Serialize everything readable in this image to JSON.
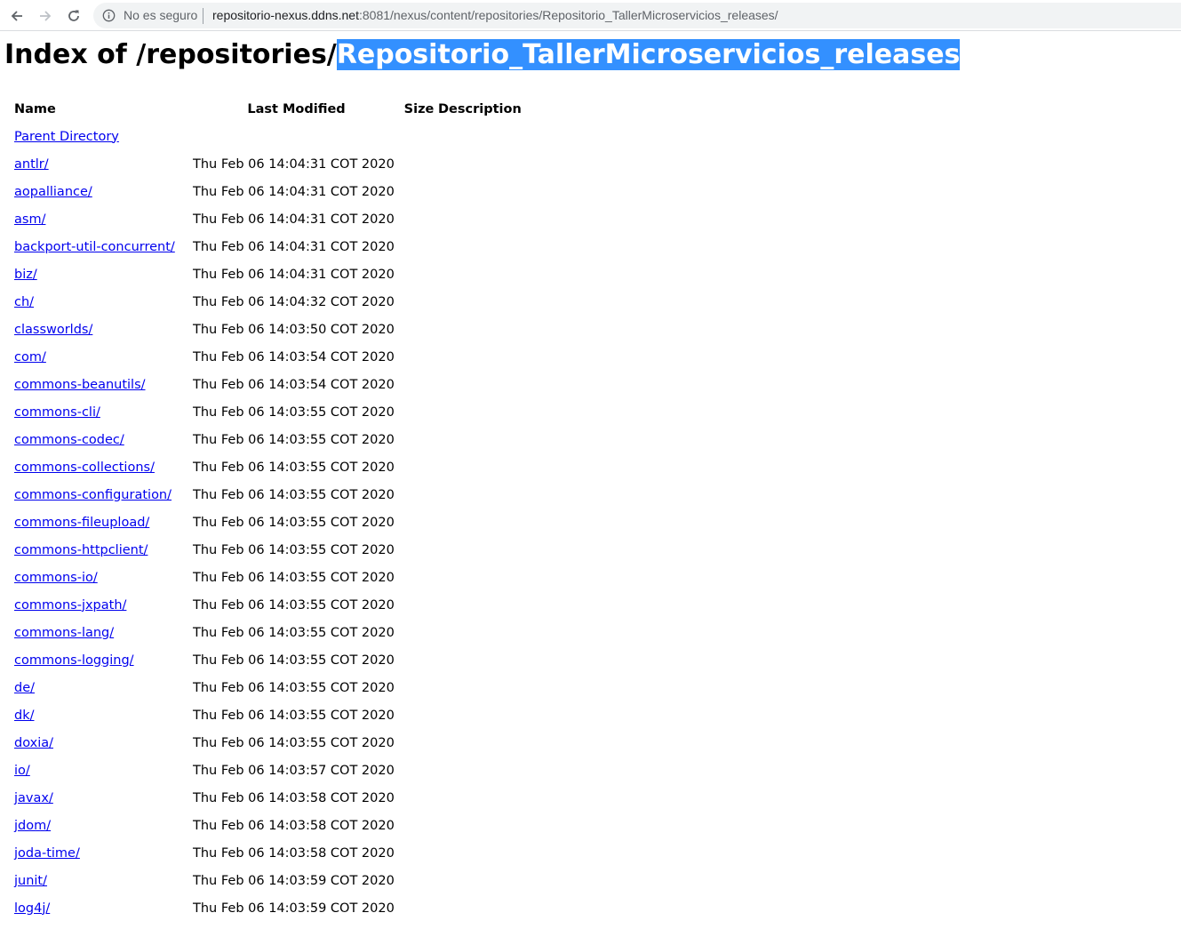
{
  "browser": {
    "security_label": "No es seguro",
    "url_host": "repositorio-nexus.ddns.net",
    "url_path": ":8081/nexus/content/repositories/Repositorio_TallerMicroservicios_releases/"
  },
  "page": {
    "title_prefix": "Index of /repositories/",
    "title_selected": "Repositorio_TallerMicroservicios_releases"
  },
  "table": {
    "headers": {
      "name": "Name",
      "last_modified": "Last Modified",
      "size": "Size",
      "description": "Description"
    },
    "parent_label": "Parent Directory",
    "rows": [
      {
        "name": "antlr/",
        "modified": "Thu Feb 06 14:04:31 COT 2020"
      },
      {
        "name": "aopalliance/",
        "modified": "Thu Feb 06 14:04:31 COT 2020"
      },
      {
        "name": "asm/",
        "modified": "Thu Feb 06 14:04:31 COT 2020"
      },
      {
        "name": "backport-util-concurrent/",
        "modified": "Thu Feb 06 14:04:31 COT 2020"
      },
      {
        "name": "biz/",
        "modified": "Thu Feb 06 14:04:31 COT 2020"
      },
      {
        "name": "ch/",
        "modified": "Thu Feb 06 14:04:32 COT 2020"
      },
      {
        "name": "classworlds/",
        "modified": "Thu Feb 06 14:03:50 COT 2020"
      },
      {
        "name": "com/",
        "modified": "Thu Feb 06 14:03:54 COT 2020"
      },
      {
        "name": "commons-beanutils/",
        "modified": "Thu Feb 06 14:03:54 COT 2020"
      },
      {
        "name": "commons-cli/",
        "modified": "Thu Feb 06 14:03:55 COT 2020"
      },
      {
        "name": "commons-codec/",
        "modified": "Thu Feb 06 14:03:55 COT 2020"
      },
      {
        "name": "commons-collections/",
        "modified": "Thu Feb 06 14:03:55 COT 2020"
      },
      {
        "name": "commons-configuration/",
        "modified": "Thu Feb 06 14:03:55 COT 2020"
      },
      {
        "name": "commons-fileupload/",
        "modified": "Thu Feb 06 14:03:55 COT 2020"
      },
      {
        "name": "commons-httpclient/",
        "modified": "Thu Feb 06 14:03:55 COT 2020"
      },
      {
        "name": "commons-io/",
        "modified": "Thu Feb 06 14:03:55 COT 2020"
      },
      {
        "name": "commons-jxpath/",
        "modified": "Thu Feb 06 14:03:55 COT 2020"
      },
      {
        "name": "commons-lang/",
        "modified": "Thu Feb 06 14:03:55 COT 2020"
      },
      {
        "name": "commons-logging/",
        "modified": "Thu Feb 06 14:03:55 COT 2020"
      },
      {
        "name": "de/",
        "modified": "Thu Feb 06 14:03:55 COT 2020"
      },
      {
        "name": "dk/",
        "modified": "Thu Feb 06 14:03:55 COT 2020"
      },
      {
        "name": "doxia/",
        "modified": "Thu Feb 06 14:03:55 COT 2020"
      },
      {
        "name": "io/",
        "modified": "Thu Feb 06 14:03:57 COT 2020"
      },
      {
        "name": "javax/",
        "modified": "Thu Feb 06 14:03:58 COT 2020"
      },
      {
        "name": "jdom/",
        "modified": "Thu Feb 06 14:03:58 COT 2020"
      },
      {
        "name": "joda-time/",
        "modified": "Thu Feb 06 14:03:58 COT 2020"
      },
      {
        "name": "junit/",
        "modified": "Thu Feb 06 14:03:59 COT 2020"
      },
      {
        "name": "log4j/",
        "modified": "Thu Feb 06 14:03:59 COT 2020"
      }
    ]
  }
}
